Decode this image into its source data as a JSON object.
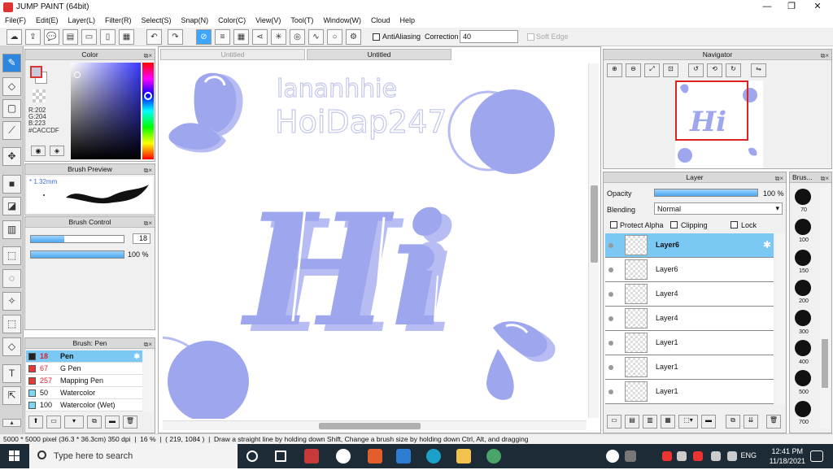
{
  "window": {
    "title": "JUMP PAINT (64bit)",
    "minimize": "—",
    "maximize": "❐",
    "close": "✕"
  },
  "menu": [
    "File(F)",
    "Edit(E)",
    "Layer(L)",
    "Filter(R)",
    "Select(S)",
    "Snap(N)",
    "Color(C)",
    "View(V)",
    "Tool(T)",
    "Window(W)",
    "Cloud",
    "Help"
  ],
  "toolbar": {
    "antialiasing_label": "AntiAliasing",
    "correction_label": "Correction",
    "correction_value": "40",
    "soft_edge_label": "Soft Edge"
  },
  "color_panel": {
    "title": "Color",
    "r": "R:202",
    "g": "G:204",
    "b": "B:223",
    "hex": "#CACCDF",
    "current_color": "#cacadf"
  },
  "brush_preview": {
    "title": "Brush Preview",
    "size": "* 1.32mm"
  },
  "brush_control": {
    "title": "Brush Control",
    "size_value": "18",
    "opacity_value": "100 %",
    "size_fraction": 0.36,
    "opacity_fraction": 1.0
  },
  "brush_list": {
    "title": "Brush: Pen",
    "items": [
      {
        "size": "18",
        "name": "Pen",
        "color": "#222222",
        "selected": true
      },
      {
        "size": "67",
        "name": "G Pen",
        "color": "#e53935",
        "selected": false
      },
      {
        "size": "257",
        "name": "Mapping Pen",
        "color": "#e53935",
        "selected": false
      },
      {
        "size": "50",
        "name": "Watercolor",
        "color": "#7fd6f5",
        "selected": false
      },
      {
        "size": "100",
        "name": "Watercolor (Wet)",
        "color": "#7fd6f5",
        "selected": false
      }
    ]
  },
  "canvas": {
    "tabs": [
      "Untitled",
      "Untitled"
    ],
    "handwriting_line1": "lananhhie",
    "handwriting_line2": "HoiDap247",
    "big_letters": "Hi",
    "art_color": "#9ea6ee"
  },
  "navigator": {
    "title": "Navigator"
  },
  "layer_panel": {
    "title": "Layer",
    "opacity_label": "Opacity",
    "opacity_value": "100 %",
    "blending_label": "Blending",
    "blending_value": "Normal",
    "protect_alpha": "Protect Alpha",
    "clipping": "Clipping",
    "lock": "Lock",
    "layers": [
      "Layer6",
      "Layer6",
      "Layer4",
      "Layer4",
      "Layer1",
      "Layer1",
      "Layer1"
    ]
  },
  "brush_sizes": {
    "title": "Brus...",
    "labels": [
      "70",
      "100",
      "150",
      "200",
      "300",
      "400",
      "500",
      "700"
    ]
  },
  "status": {
    "size": "5000 * 5000 pixel",
    "physical": "(36.3 * 36.3cm)",
    "dpi": "350 dpi",
    "zoom": "16 %",
    "coords": "( 219, 1084 )",
    "hint": "Draw a straight line by holding down Shift, Change a brush size by holding down Ctrl, Alt, and dragging"
  },
  "taskbar": {
    "search_placeholder": "Type here to search",
    "lang": "ENG",
    "time": "12:41 PM",
    "date": "11/18/2021"
  }
}
